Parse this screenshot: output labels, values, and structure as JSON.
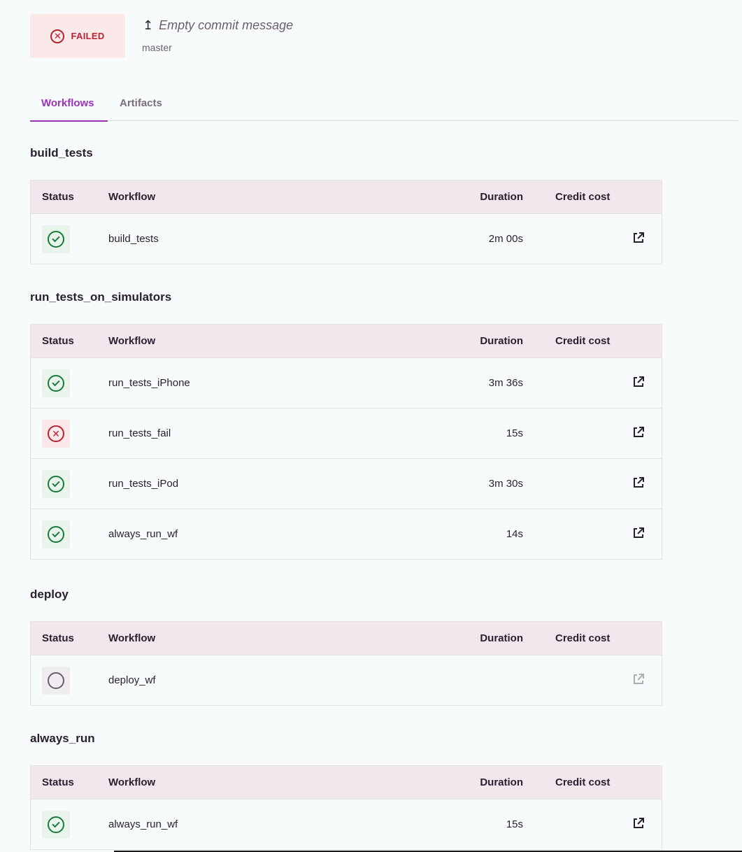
{
  "header": {
    "status_label": "FAILED",
    "status_icon": "x-circle-icon",
    "commit_message": "Empty commit message",
    "branch": "master",
    "status_color": "#b8232f"
  },
  "tabs": [
    {
      "label": "Workflows",
      "active": true
    },
    {
      "label": "Artifacts",
      "active": false
    }
  ],
  "columns": {
    "status": "Status",
    "workflow": "Workflow",
    "duration": "Duration",
    "credit_cost": "Credit cost"
  },
  "stages": [
    {
      "title": "build_tests",
      "rows": [
        {
          "status": "success",
          "workflow": "build_tests",
          "duration": "2m 00s",
          "credit_cost": ""
        }
      ]
    },
    {
      "title": "run_tests_on_simulators",
      "rows": [
        {
          "status": "success",
          "workflow": "run_tests_iPhone",
          "duration": "3m 36s",
          "credit_cost": ""
        },
        {
          "status": "failed",
          "workflow": "run_tests_fail",
          "duration": "15s",
          "credit_cost": ""
        },
        {
          "status": "success",
          "workflow": "run_tests_iPod",
          "duration": "3m 30s",
          "credit_cost": ""
        },
        {
          "status": "success",
          "workflow": "always_run_wf",
          "duration": "14s",
          "credit_cost": ""
        }
      ]
    },
    {
      "title": "deploy",
      "rows": [
        {
          "status": "pending",
          "workflow": "deploy_wf",
          "duration": "",
          "credit_cost": ""
        }
      ]
    },
    {
      "title": "always_run",
      "rows": [
        {
          "status": "success",
          "workflow": "always_run_wf",
          "duration": "15s",
          "credit_cost": ""
        }
      ]
    }
  ],
  "colors": {
    "accent": "#9b33b8",
    "success": "#1a7a3a",
    "failed": "#b8232f",
    "pending": "#6b5f6e"
  }
}
